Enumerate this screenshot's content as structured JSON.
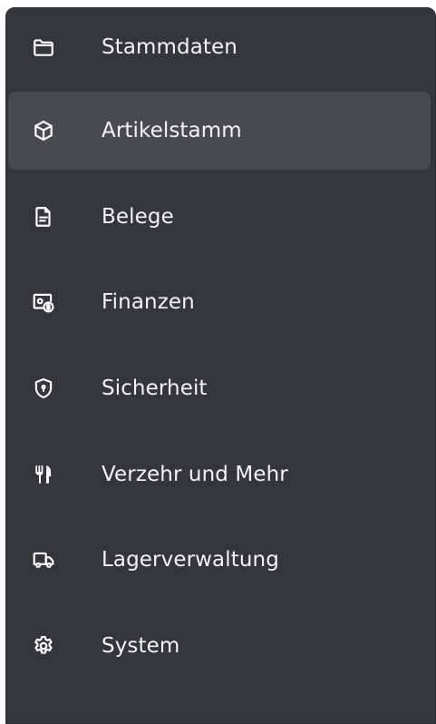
{
  "sidebar": {
    "items": [
      {
        "label": "Stammdaten",
        "icon": "folder-icon"
      },
      {
        "label": "Artikelstamm",
        "icon": "cube-icon",
        "active": true
      },
      {
        "label": "Belege",
        "icon": "document-icon"
      },
      {
        "label": "Finanzen",
        "icon": "money-icon"
      },
      {
        "label": "Sicherheit",
        "icon": "shield-icon"
      },
      {
        "label": "Verzehr und Mehr",
        "icon": "cutlery-icon"
      },
      {
        "label": "Lagerverwaltung",
        "icon": "truck-icon"
      },
      {
        "label": "System",
        "icon": "gear-icon"
      }
    ]
  },
  "colors": {
    "panel_background": "#33363d",
    "active_background": "#474b51",
    "text": "#f2f3f5",
    "icon": "#ffffff"
  }
}
